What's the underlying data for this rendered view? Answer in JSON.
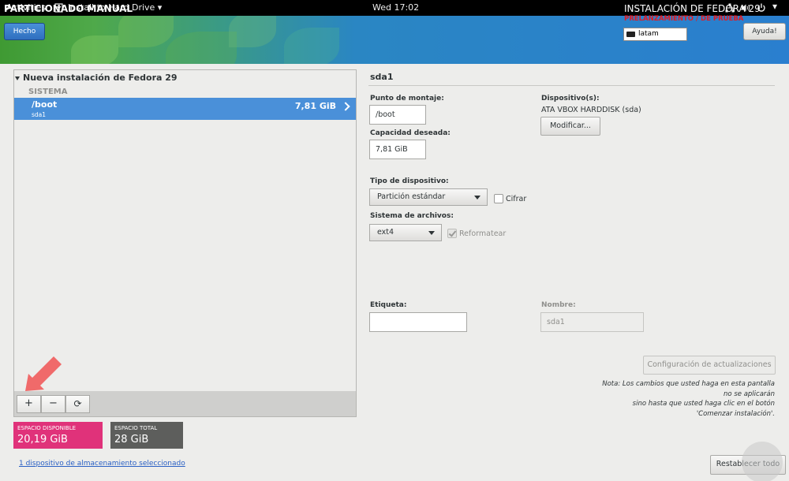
{
  "topbar": {
    "activities": "Activities",
    "app_name": "Install to Hard Drive",
    "clock": "Wed 17:02"
  },
  "header": {
    "title": "PARTICIONADO MANUAL",
    "done_label": "Hecho",
    "install_title": "INSTALACIÓN DE FEDORA 29",
    "prerelease": "PRELANZAMIENTO / DE PRUEBA",
    "keyboard_layout": "latam",
    "help_label": "Ayuda!"
  },
  "tree": {
    "header": "Nueva instalación de Fedora 29",
    "group": "SISTEMA",
    "items": [
      {
        "mount": "/boot",
        "device": "sda1",
        "size": "7,81 GiB"
      }
    ]
  },
  "toolbar": {
    "add": "+",
    "remove": "−",
    "refresh": "⟳"
  },
  "space": {
    "available_label": "ESPACIO DISPONIBLE",
    "available_value": "20,19 GiB",
    "total_label": "ESPACIO TOTAL",
    "total_value": "28 GiB"
  },
  "devices_link": "1 dispositivo de almacenamiento seleccionado",
  "details": {
    "title": "sda1",
    "mount_label": "Punto de montaje:",
    "mount_value": "/boot",
    "capacity_label": "Capacidad deseada:",
    "capacity_value": "7,81 GiB",
    "devices_label": "Dispositivo(s):",
    "devices_value": "ATA VBOX HARDDISK (sda)",
    "modify_label": "Modificar...",
    "device_type_label": "Tipo de dispositivo:",
    "device_type_value": "Partición estándar",
    "encrypt_label": "Cifrar",
    "encrypt_checked": false,
    "filesystem_label": "Sistema de archivos:",
    "filesystem_value": "ext4",
    "reformat_label": "Reformatear",
    "reformat_checked": true,
    "tag_label": "Etiqueta:",
    "tag_value": "",
    "name_label": "Nombre:",
    "name_value": "sda1",
    "update_label": "Configuración de actualizaciones",
    "note_lines": [
      "Nota: Los cambios que  usted haga en esta pantalla",
      "no se aplicarán",
      "sino hasta que usted haga clic en el botón",
      "'Comenzar instalación'."
    ],
    "reset_label": "Restablecer todo"
  },
  "colors": {
    "selection": "#4a90d9",
    "available": "#e0327a",
    "total": "#5d5e5c",
    "prerelease": "#e01b24",
    "annotation_arrow": "#f06a6a"
  }
}
